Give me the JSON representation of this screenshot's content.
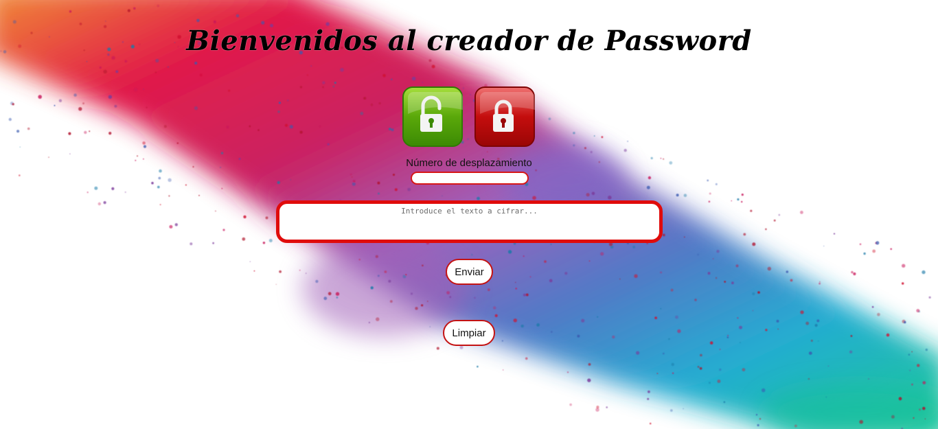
{
  "page": {
    "title": "Bienvenidos al creador de Password"
  },
  "controls": {
    "encrypt_icon": "unlocked-padlock-icon",
    "decrypt_icon": "locked-padlock-icon",
    "encrypt_color": "#5aa80a",
    "decrypt_color": "#c40d0d",
    "shift_label": "Número de desplazamiento",
    "shift_value": "",
    "text_placeholder": "Introduce el texto a cifrar...",
    "text_value": "",
    "send_label": "Enviar",
    "clear_label": "Limpiar"
  },
  "theme": {
    "accent": "#e00b0b",
    "background_splash": [
      "#f08a2a",
      "#e01040",
      "#9a5ab8",
      "#3a78c8",
      "#1aa8d0",
      "#10c890"
    ]
  }
}
